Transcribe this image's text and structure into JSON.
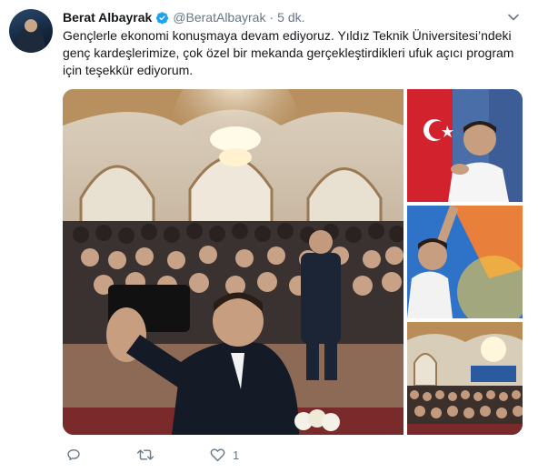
{
  "author": {
    "name": "Berat Albayrak",
    "handle": "@BeratAlbayrak",
    "separator": "·",
    "time": "5 dk.",
    "verified": true,
    "accent_color": "#1da1f2"
  },
  "tweet": {
    "text": "Gençlerle ekonomi konuşmaya devam ediyoruz. Yıldız Teknik Üniversitesi’ndeki genç kardeşlerimize, çok özel bir mekanda gerçekleştirdikleri ufuk açıcı program için teşekkür ediyorum."
  },
  "media": {
    "photos": [
      {
        "subject": "selfie-in-ornate-hall"
      },
      {
        "subject": "speaker-in-front-of-flag"
      },
      {
        "subject": "speaker-at-podium"
      },
      {
        "subject": "audience-in-hall"
      }
    ]
  },
  "actions": {
    "reply_icon": "reply-icon",
    "retweet_icon": "retweet-icon",
    "like_icon": "like-icon",
    "like_count": "1"
  },
  "colors": {
    "text": "#14171a",
    "secondary": "#657786"
  }
}
